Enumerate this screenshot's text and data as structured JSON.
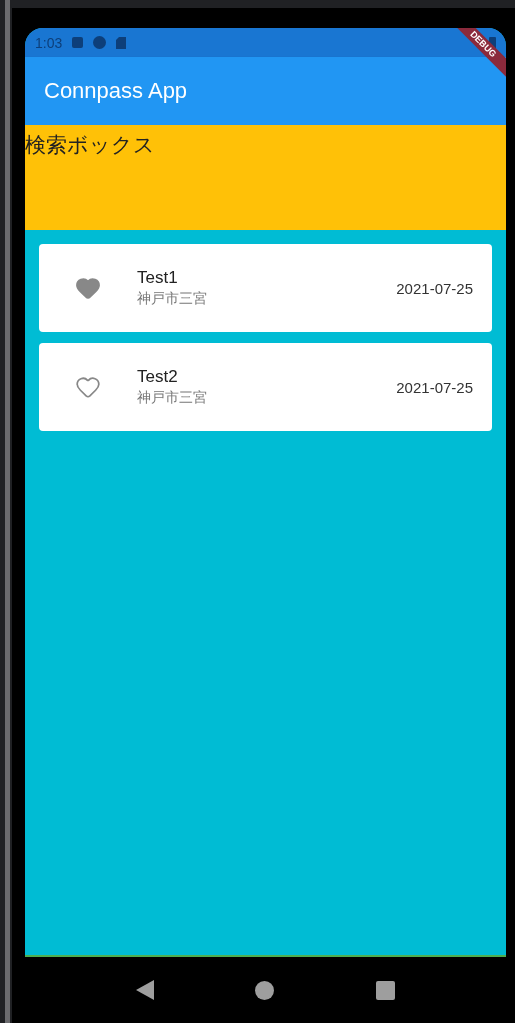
{
  "status_bar": {
    "time": "1:03"
  },
  "debug_banner": "DEBUG",
  "app_bar": {
    "title": "Connpass App"
  },
  "search_box": {
    "label": "検索ボックス"
  },
  "events": [
    {
      "title": "Test1",
      "place": "神戸市三宮",
      "date": "2021-07-25",
      "favorite": true
    },
    {
      "title": "Test2",
      "place": "神戸市三宮",
      "date": "2021-07-25",
      "favorite": false
    }
  ]
}
